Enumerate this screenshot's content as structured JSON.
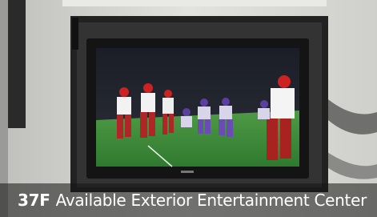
{
  "photo": {
    "subject": "RV exterior entertainment center with wall-mounted TV showing a football game",
    "tv_brand": "VIZIO"
  },
  "caption": {
    "model": "37F",
    "text": "Available Exterior Entertainment Center"
  },
  "colors": {
    "caption_text": "#ffffff",
    "caption_bg": "#141414",
    "rv_wall": "#d9d9d6",
    "tv_bezel": "#141414",
    "field_green": "#3d8a3a"
  }
}
